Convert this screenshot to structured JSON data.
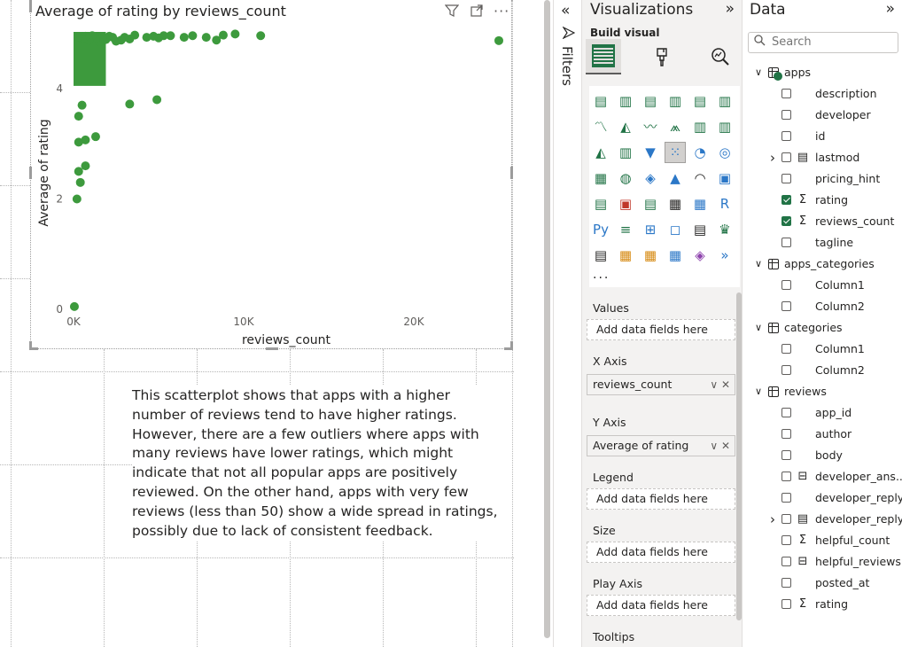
{
  "chart_data": {
    "type": "scatter",
    "title": "Average of rating by reviews_count",
    "xlabel": "reviews_count",
    "ylabel": "Average of rating",
    "xlim": [
      0,
      26000
    ],
    "ylim": [
      0,
      5
    ],
    "xticks": [
      "0K",
      "10K",
      "20K"
    ],
    "xtick_values": [
      0,
      10000,
      20000
    ],
    "yticks": [
      "0",
      "2",
      "4"
    ],
    "ytick_values": [
      0,
      2,
      4
    ],
    "color": "#3d9a3d",
    "grid": false,
    "points": [
      {
        "x": 25000,
        "y": 4.87
      },
      {
        "x": 11000,
        "y": 4.96
      },
      {
        "x": 9500,
        "y": 4.99
      },
      {
        "x": 8800,
        "y": 4.97
      },
      {
        "x": 8400,
        "y": 4.88
      },
      {
        "x": 7800,
        "y": 4.93
      },
      {
        "x": 7000,
        "y": 4.96
      },
      {
        "x": 6500,
        "y": 4.93
      },
      {
        "x": 5700,
        "y": 4.96
      },
      {
        "x": 5300,
        "y": 4.96
      },
      {
        "x": 5000,
        "y": 4.92
      },
      {
        "x": 4700,
        "y": 4.95
      },
      {
        "x": 4300,
        "y": 4.93
      },
      {
        "x": 3600,
        "y": 4.97
      },
      {
        "x": 3300,
        "y": 4.9
      },
      {
        "x": 3000,
        "y": 4.93
      },
      {
        "x": 2800,
        "y": 4.88
      },
      {
        "x": 2500,
        "y": 4.86
      },
      {
        "x": 2300,
        "y": 4.93
      },
      {
        "x": 2100,
        "y": 4.95
      },
      {
        "x": 1900,
        "y": 4.89
      },
      {
        "x": 1700,
        "y": 4.92
      },
      {
        "x": 1500,
        "y": 4.85
      },
      {
        "x": 1300,
        "y": 4.9
      },
      {
        "x": 1100,
        "y": 4.96
      },
      {
        "x": 900,
        "y": 4.88
      },
      {
        "x": 700,
        "y": 4.95
      },
      {
        "x": 500,
        "y": 4.9
      },
      {
        "x": 300,
        "y": 4.94
      },
      {
        "x": 4900,
        "y": 3.8
      },
      {
        "x": 3300,
        "y": 3.72
      },
      {
        "x": 1300,
        "y": 3.13
      },
      {
        "x": 700,
        "y": 3.07
      },
      {
        "x": 300,
        "y": 3.03
      },
      {
        "x": 300,
        "y": 3.5
      },
      {
        "x": 500,
        "y": 3.7
      },
      {
        "x": 300,
        "y": 2.5
      },
      {
        "x": 700,
        "y": 2.6
      },
      {
        "x": 400,
        "y": 2.3
      },
      {
        "x": 200,
        "y": 2.0
      },
      {
        "x": 50,
        "y": 0.05
      }
    ]
  },
  "visual_header": {
    "filter_icon": "filter-icon",
    "focus_icon": "focus-mode-icon",
    "more_icon": "more-options-icon"
  },
  "narrative": "This scatterplot shows that apps with a higher number of reviews tend to have higher ratings. However, there are a few outliers where apps with many reviews have lower ratings, which might indicate that not all popular apps are positively reviewed. On the other hand, apps with very few reviews (less than 50) show a wide spread in ratings, possibly due to lack of consistent feedback.",
  "filters_pane": {
    "label": "Filters"
  },
  "viz_pane": {
    "title": "Visualizations",
    "build_label": "Build visual",
    "more_label": "...",
    "wells": [
      {
        "label": "Values",
        "value": "Add data fields here",
        "filled": false
      },
      {
        "label": "X Axis",
        "value": "reviews_count",
        "filled": true
      },
      {
        "label": "Y Axis",
        "value": "Average of rating",
        "filled": true
      },
      {
        "label": "Legend",
        "value": "Add data fields here",
        "filled": false
      },
      {
        "label": "Size",
        "value": "Add data fields here",
        "filled": false
      },
      {
        "label": "Play Axis",
        "value": "Add data fields here",
        "filled": false
      },
      {
        "label": "Tooltips",
        "value": "",
        "filled": false
      }
    ],
    "gallery_icons": [
      [
        "stacked-bar-icon",
        "stacked-column-icon",
        "clustered-bar-icon",
        "clustered-column-icon",
        "100-bar-icon",
        "100-column-icon"
      ],
      [
        "line-icon",
        "area-icon",
        "stacked-area-icon",
        "ribbon-icon",
        "line-column-icon",
        "line-clustered-icon"
      ],
      [
        "ribbon-chart-icon",
        "waterfall-icon",
        "funnel-icon",
        "scatter-icon",
        "pie-icon",
        "donut-icon"
      ],
      [
        "treemap-icon",
        "map-icon",
        "filled-map-icon",
        "azure-map-icon",
        "gauge-icon",
        "card-icon"
      ],
      [
        "multirow-card-icon",
        "kpi-icon",
        "slicer-icon",
        "table-icon",
        "matrix-icon",
        "r-visual-icon"
      ],
      [
        "python-visual-icon",
        "key-influencers-icon",
        "decomposition-tree-icon",
        "qa-icon",
        "smart-narrative-icon",
        "metrics-icon"
      ],
      [
        "paginated-report-icon",
        "power-apps-icon",
        "power-automate-icon",
        "custom-visual-icon",
        "diamond-visual-icon",
        "chevron-visual-icon"
      ]
    ]
  },
  "data_pane": {
    "title": "Data",
    "search_placeholder": "Search",
    "rows": [
      {
        "kind": "table",
        "label": "apps",
        "indent": 0,
        "expanded": true,
        "badge": true
      },
      {
        "kind": "field",
        "label": "description",
        "indent": 1,
        "checked": false,
        "type": ""
      },
      {
        "kind": "field",
        "label": "developer",
        "indent": 1,
        "checked": false,
        "type": ""
      },
      {
        "kind": "field",
        "label": "id",
        "indent": 1,
        "checked": false,
        "type": ""
      },
      {
        "kind": "field",
        "label": "lastmod",
        "indent": 1,
        "checked": false,
        "type": "hierarchy",
        "expander": true
      },
      {
        "kind": "field",
        "label": "pricing_hint",
        "indent": 1,
        "checked": false,
        "type": ""
      },
      {
        "kind": "field",
        "label": "rating",
        "indent": 1,
        "checked": true,
        "type": "sum"
      },
      {
        "kind": "field",
        "label": "reviews_count",
        "indent": 1,
        "checked": true,
        "type": "sum"
      },
      {
        "kind": "field",
        "label": "tagline",
        "indent": 1,
        "checked": false,
        "type": ""
      },
      {
        "kind": "table",
        "label": "apps_categories",
        "indent": 0,
        "expanded": true
      },
      {
        "kind": "field",
        "label": "Column1",
        "indent": 1,
        "checked": false,
        "type": ""
      },
      {
        "kind": "field",
        "label": "Column2",
        "indent": 1,
        "checked": false,
        "type": ""
      },
      {
        "kind": "table",
        "label": "categories",
        "indent": 0,
        "expanded": true
      },
      {
        "kind": "field",
        "label": "Column1",
        "indent": 1,
        "checked": false,
        "type": ""
      },
      {
        "kind": "field",
        "label": "Column2",
        "indent": 1,
        "checked": false,
        "type": ""
      },
      {
        "kind": "table",
        "label": "reviews",
        "indent": 0,
        "expanded": true
      },
      {
        "kind": "field",
        "label": "app_id",
        "indent": 1,
        "checked": false,
        "type": ""
      },
      {
        "kind": "field",
        "label": "author",
        "indent": 1,
        "checked": false,
        "type": ""
      },
      {
        "kind": "field",
        "label": "body",
        "indent": 1,
        "checked": false,
        "type": ""
      },
      {
        "kind": "field",
        "label": "developer_ans...",
        "indent": 1,
        "checked": false,
        "type": "calc"
      },
      {
        "kind": "field",
        "label": "developer_reply",
        "indent": 1,
        "checked": false,
        "type": ""
      },
      {
        "kind": "field",
        "label": "developer_reply...",
        "indent": 1,
        "checked": false,
        "type": "hierarchy",
        "expander": true
      },
      {
        "kind": "field",
        "label": "helpful_count",
        "indent": 1,
        "checked": false,
        "type": "sum"
      },
      {
        "kind": "field",
        "label": "helpful_reviews",
        "indent": 1,
        "checked": false,
        "type": "calc"
      },
      {
        "kind": "field",
        "label": "posted_at",
        "indent": 1,
        "checked": false,
        "type": ""
      },
      {
        "kind": "field",
        "label": "rating",
        "indent": 1,
        "checked": false,
        "type": "sum"
      }
    ]
  }
}
